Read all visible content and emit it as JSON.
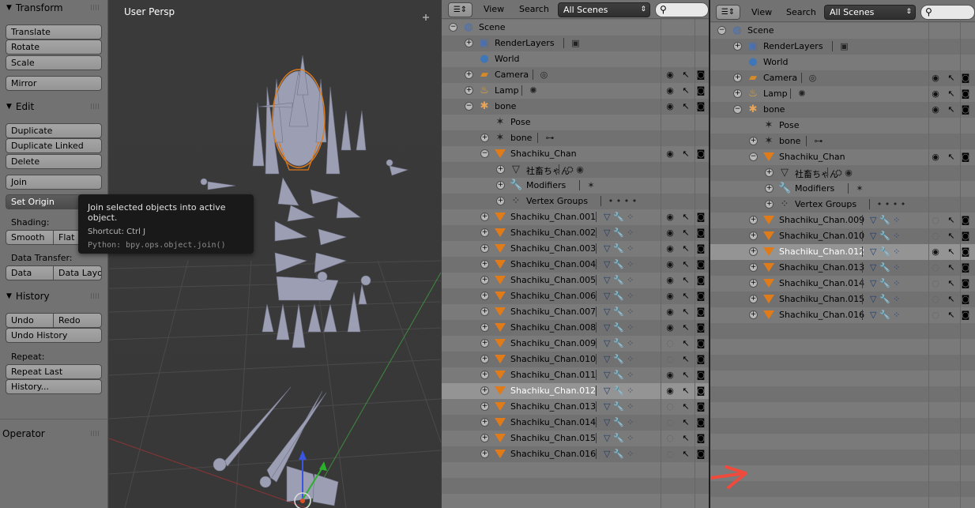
{
  "toolshelf": {
    "transform": {
      "title": "Transform",
      "buttons": [
        "Translate",
        "Rotate",
        "Scale"
      ],
      "mirror": "Mirror"
    },
    "edit": {
      "title": "Edit",
      "buttons": [
        "Duplicate",
        "Duplicate Linked",
        "Delete"
      ],
      "join": "Join",
      "set_origin": "Set Origin",
      "shading_label": "Shading:",
      "smooth": "Smooth",
      "flat": "Flat",
      "data_transfer_label": "Data Transfer:",
      "data": "Data",
      "data_layout": "Data Layo"
    },
    "history": {
      "title": "History",
      "undo": "Undo",
      "redo": "Redo",
      "undo_history": "Undo History",
      "repeat_label": "Repeat:",
      "repeat_last": "Repeat Last",
      "history_menu": "History..."
    },
    "operator": {
      "title": "Operator"
    }
  },
  "viewport": {
    "title": "User Persp",
    "tooltip": {
      "description": "Join selected objects into active object.",
      "shortcut": "Shortcut: Ctrl J",
      "python": "Python: bpy.ops.object.join()"
    }
  },
  "outliner_left": {
    "menu_view": "View",
    "menu_search": "Search",
    "scene_filter": "All Scenes",
    "rows": [
      {
        "label": "Scene",
        "icon": "scene-icon",
        "depth": 0,
        "expander": "minus",
        "vis": false
      },
      {
        "label": "RenderLayers",
        "icon": "renderlayers-icon",
        "depth": 1,
        "expander": "plus",
        "vis": false,
        "sub": "render-layer-icon"
      },
      {
        "label": "World",
        "icon": "world-icon",
        "depth": 1,
        "expander": "none",
        "vis": false
      },
      {
        "label": "Camera",
        "icon": "camera-icon",
        "depth": 1,
        "expander": "plus",
        "vis": true,
        "sub": "camera-data-icon"
      },
      {
        "label": "Lamp",
        "icon": "lamp-icon",
        "depth": 1,
        "expander": "plus",
        "vis": true,
        "sub": "lamp-data-icon"
      },
      {
        "label": "bone",
        "icon": "armature-icon",
        "depth": 1,
        "expander": "minus",
        "vis": true
      },
      {
        "label": "Pose",
        "icon": "pose-icon",
        "depth": 2,
        "expander": "none",
        "vis": false
      },
      {
        "label": "bone",
        "icon": "armature-data-icon",
        "depth": 2,
        "expander": "plus",
        "vis": false,
        "sub": "bone-icon"
      },
      {
        "label": "Shachiku_Chan",
        "icon": "mesh-object-icon",
        "depth": 2,
        "expander": "minus",
        "vis": true
      },
      {
        "label": "社畜ちゃん",
        "icon": "mesh-data-icon",
        "depth": 3,
        "expander": "plus",
        "vis": false,
        "sub": "material-icon"
      },
      {
        "label": "Modifiers",
        "icon": "wrench-icon",
        "depth": 3,
        "expander": "plus",
        "vis": false,
        "sub": "armature-modifier-icon"
      },
      {
        "label": "Vertex Groups",
        "icon": "vertex-groups-icon",
        "depth": 3,
        "expander": "plus",
        "vis": false,
        "sub": "dots-icon"
      },
      {
        "label": "Shachiku_Chan.001",
        "icon": "mesh-object-icon",
        "depth": 2,
        "expander": "plus",
        "vis": true,
        "sub": "mesh-mods"
      },
      {
        "label": "Shachiku_Chan.002",
        "icon": "mesh-object-icon",
        "depth": 2,
        "expander": "plus",
        "vis": true,
        "sub": "mesh-mods"
      },
      {
        "label": "Shachiku_Chan.003",
        "icon": "mesh-object-icon",
        "depth": 2,
        "expander": "plus",
        "vis": true,
        "sub": "mesh-mods"
      },
      {
        "label": "Shachiku_Chan.004",
        "icon": "mesh-object-icon",
        "depth": 2,
        "expander": "plus",
        "vis": true,
        "sub": "mesh-mods"
      },
      {
        "label": "Shachiku_Chan.005",
        "icon": "mesh-object-icon",
        "depth": 2,
        "expander": "plus",
        "vis": true,
        "sub": "mesh-mods"
      },
      {
        "label": "Shachiku_Chan.006",
        "icon": "mesh-object-icon",
        "depth": 2,
        "expander": "plus",
        "vis": true,
        "sub": "mesh-mods"
      },
      {
        "label": "Shachiku_Chan.007",
        "icon": "mesh-object-icon",
        "depth": 2,
        "expander": "plus",
        "vis": true,
        "sub": "mesh-mods"
      },
      {
        "label": "Shachiku_Chan.008",
        "icon": "mesh-object-icon",
        "depth": 2,
        "expander": "plus",
        "vis": true,
        "sub": "mesh-mods"
      },
      {
        "label": "Shachiku_Chan.009",
        "icon": "mesh-object-icon",
        "depth": 2,
        "expander": "plus",
        "vis": false,
        "sub": "mesh-mods"
      },
      {
        "label": "Shachiku_Chan.010",
        "icon": "mesh-object-icon",
        "depth": 2,
        "expander": "plus",
        "vis": false,
        "sub": "mesh-mods"
      },
      {
        "label": "Shachiku_Chan.011",
        "icon": "mesh-object-icon",
        "depth": 2,
        "expander": "plus",
        "vis": true,
        "sub": "mesh-mods"
      },
      {
        "label": "Shachiku_Chan.012",
        "icon": "mesh-object-icon",
        "depth": 2,
        "expander": "plus",
        "vis": true,
        "sub": "mesh-mods",
        "highlight": true
      },
      {
        "label": "Shachiku_Chan.013",
        "icon": "mesh-object-icon",
        "depth": 2,
        "expander": "plus",
        "vis": false,
        "sub": "mesh-mods"
      },
      {
        "label": "Shachiku_Chan.014",
        "icon": "mesh-object-icon",
        "depth": 2,
        "expander": "plus",
        "vis": false,
        "sub": "mesh-mods"
      },
      {
        "label": "Shachiku_Chan.015",
        "icon": "mesh-object-icon",
        "depth": 2,
        "expander": "plus",
        "vis": false,
        "sub": "mesh-mods"
      },
      {
        "label": "Shachiku_Chan.016",
        "icon": "mesh-object-icon",
        "depth": 2,
        "expander": "plus",
        "vis": false,
        "sub": "mesh-mods"
      }
    ]
  },
  "outliner_right": {
    "menu_view": "View",
    "menu_search": "Search",
    "scene_filter": "All Scenes",
    "rows": [
      {
        "label": "Scene",
        "icon": "scene-icon",
        "depth": 0,
        "expander": "minus",
        "vis": false
      },
      {
        "label": "RenderLayers",
        "icon": "renderlayers-icon",
        "depth": 1,
        "expander": "plus",
        "vis": false,
        "sub": "render-layer-icon"
      },
      {
        "label": "World",
        "icon": "world-icon",
        "depth": 1,
        "expander": "none",
        "vis": false
      },
      {
        "label": "Camera",
        "icon": "camera-icon",
        "depth": 1,
        "expander": "plus",
        "vis": true,
        "sub": "camera-data-icon"
      },
      {
        "label": "Lamp",
        "icon": "lamp-icon",
        "depth": 1,
        "expander": "plus",
        "vis": true,
        "sub": "lamp-data-icon"
      },
      {
        "label": "bone",
        "icon": "armature-icon",
        "depth": 1,
        "expander": "minus",
        "vis": true
      },
      {
        "label": "Pose",
        "icon": "pose-icon",
        "depth": 2,
        "expander": "none",
        "vis": false
      },
      {
        "label": "bone",
        "icon": "armature-data-icon",
        "depth": 2,
        "expander": "plus",
        "vis": false,
        "sub": "bone-icon"
      },
      {
        "label": "Shachiku_Chan",
        "icon": "mesh-object-icon",
        "depth": 2,
        "expander": "minus",
        "vis": true
      },
      {
        "label": "社畜ちゃん",
        "icon": "mesh-data-icon",
        "depth": 3,
        "expander": "plus",
        "vis": false,
        "sub": "material-icon"
      },
      {
        "label": "Modifiers",
        "icon": "wrench-icon",
        "depth": 3,
        "expander": "plus",
        "vis": false,
        "sub": "armature-modifier-icon"
      },
      {
        "label": "Vertex Groups",
        "icon": "vertex-groups-icon",
        "depth": 3,
        "expander": "plus",
        "vis": false,
        "sub": "dots-icon"
      },
      {
        "label": "Shachiku_Chan.009",
        "icon": "mesh-object-icon",
        "depth": 2,
        "expander": "plus",
        "vis": false,
        "sub": "mesh-mods"
      },
      {
        "label": "Shachiku_Chan.010",
        "icon": "mesh-object-icon",
        "depth": 2,
        "expander": "plus",
        "vis": false,
        "sub": "mesh-mods"
      },
      {
        "label": "Shachiku_Chan.012",
        "icon": "mesh-object-icon",
        "depth": 2,
        "expander": "plus",
        "vis": true,
        "sub": "mesh-mods",
        "highlight": true
      },
      {
        "label": "Shachiku_Chan.013",
        "icon": "mesh-object-icon",
        "depth": 2,
        "expander": "plus",
        "vis": false,
        "sub": "mesh-mods"
      },
      {
        "label": "Shachiku_Chan.014",
        "icon": "mesh-object-icon",
        "depth": 2,
        "expander": "plus",
        "vis": false,
        "sub": "mesh-mods"
      },
      {
        "label": "Shachiku_Chan.015",
        "icon": "mesh-object-icon",
        "depth": 2,
        "expander": "plus",
        "vis": false,
        "sub": "mesh-mods"
      },
      {
        "label": "Shachiku_Chan.016",
        "icon": "mesh-object-icon",
        "depth": 2,
        "expander": "plus",
        "vis": false,
        "sub": "mesh-mods"
      }
    ]
  },
  "colors": {
    "accent_orange": "#e07b1a",
    "annotation_arrow": "#f04a3c",
    "tooltip_bg": "#191919",
    "viewport_bg": "#393939"
  }
}
